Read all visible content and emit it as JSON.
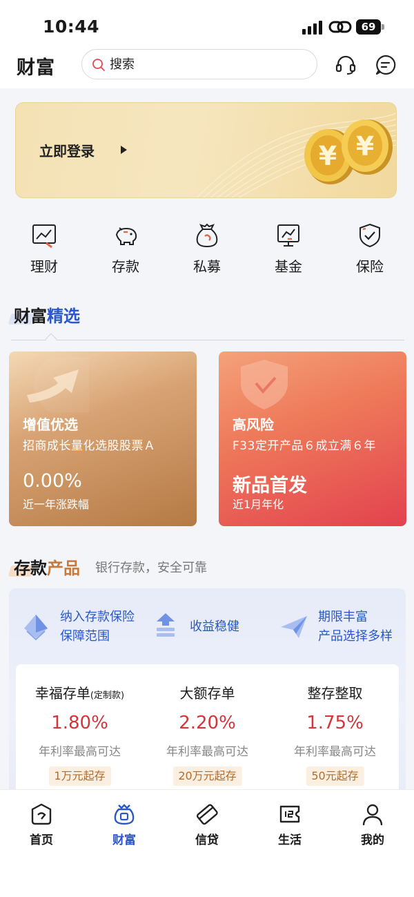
{
  "status_bar": {
    "time": "10:44",
    "battery": "69"
  },
  "header": {
    "title": "财富",
    "search_placeholder": "搜索"
  },
  "banner": {
    "login_text": "立即登录"
  },
  "categories": [
    {
      "label": "理财",
      "icon": "chart-screen-icon"
    },
    {
      "label": "存款",
      "icon": "piggy-bank-icon"
    },
    {
      "label": "私募",
      "icon": "money-bag-icon"
    },
    {
      "label": "基金",
      "icon": "fund-chart-icon"
    },
    {
      "label": "保险",
      "icon": "shield-check-icon"
    }
  ],
  "wealth_section": {
    "title_a": "财富",
    "title_b": "精选"
  },
  "products": [
    {
      "tag": "增值优选",
      "name": "招商成长量化选股股票Ａ",
      "value": "0.00%",
      "note": "近一年涨跌幅"
    },
    {
      "tag": "高风险",
      "name": "F33定开产品６成立满６年",
      "value": "新品首发",
      "note": "近1月年化"
    }
  ],
  "deposit_section": {
    "title_a": "存款",
    "title_b": "产品",
    "subtitle": "银行存款，安全可靠",
    "features": [
      {
        "line1": "纳入存款保险",
        "line2": "保障范围"
      },
      {
        "line1": "收益稳健",
        "line2": ""
      },
      {
        "line1": "期限丰富",
        "line2": "产品选择多样"
      }
    ],
    "rates": [
      {
        "name": "幸福存单",
        "suffix": "(定制款)",
        "rate": "1.80%",
        "desc": "年利率最高可达",
        "min": "1万元起存"
      },
      {
        "name": "大额存单",
        "suffix": "",
        "rate": "2.20%",
        "desc": "年利率最高可达",
        "min": "20万元起存"
      },
      {
        "name": "整存整取",
        "suffix": "",
        "rate": "1.75%",
        "desc": "年利率最高可达",
        "min": "50元起存"
      }
    ]
  },
  "tabs": [
    {
      "label": "首页",
      "active": false
    },
    {
      "label": "财富",
      "active": true
    },
    {
      "label": "信贷",
      "active": false
    },
    {
      "label": "生活",
      "active": false
    },
    {
      "label": "我的",
      "active": false
    }
  ],
  "colors": {
    "accent": "#2a57c9",
    "rate_red": "#d3353a",
    "gold": "#f4e2b4"
  }
}
